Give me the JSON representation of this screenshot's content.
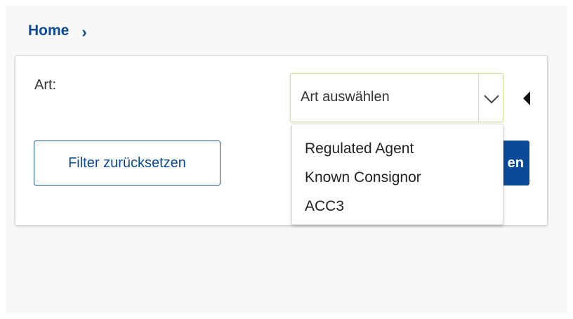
{
  "breadcrumb": {
    "home_label": "Home",
    "separator": "›"
  },
  "filter": {
    "label": "Art:",
    "select": {
      "value": "Art auswählen",
      "options": [
        "Regulated Agent",
        "Known Consignor",
        "ACC3"
      ],
      "open": true
    },
    "reset_label": "Filter zurücksetzen",
    "apply_label_visible": "en"
  },
  "colors": {
    "brand": "#0b4a99",
    "focus_border": "#d7de9e"
  },
  "icons": {
    "select_toggle": "chevron-down-icon",
    "panel_toggle": "caret-left-icon",
    "breadcrumb_separator": "chevron-right-icon"
  }
}
